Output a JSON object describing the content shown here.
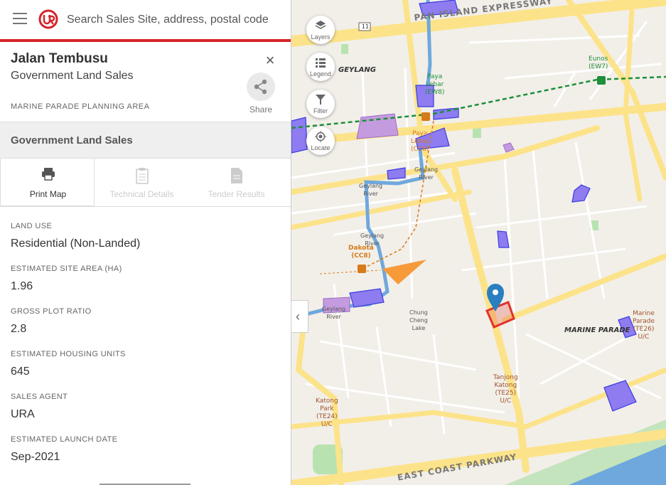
{
  "search": {
    "placeholder": "Search Sales Site, address, postal code"
  },
  "detail": {
    "title": "Jalan Tembusu",
    "subtitle": "Government Land Sales",
    "area": "MARINE PARADE PLANNING AREA",
    "share_label": "Share",
    "close_symbol": "×"
  },
  "section": {
    "title": "Government Land Sales"
  },
  "actions": [
    {
      "label": "Print Map",
      "icon": "printer-icon",
      "enabled": true
    },
    {
      "label": "Technical Details",
      "icon": "clipboard-icon",
      "enabled": false
    },
    {
      "label": "Tender Results",
      "icon": "document-icon",
      "enabled": false
    }
  ],
  "fields": [
    {
      "label": "LAND USE",
      "value": "Residential (Non-Landed)"
    },
    {
      "label": "ESTIMATED SITE AREA (HA)",
      "value": "1.96"
    },
    {
      "label": "GROSS PLOT RATIO",
      "value": "2.8"
    },
    {
      "label": "ESTIMATED HOUSING UNITS",
      "value": "645"
    },
    {
      "label": "SALES AGENT",
      "value": "URA"
    },
    {
      "label": "ESTIMATED LAUNCH DATE",
      "value": "Sep-2021"
    }
  ],
  "map_tools": [
    {
      "label": "Layers",
      "icon": "layers-icon"
    },
    {
      "label": "Legend",
      "icon": "legend-icon"
    },
    {
      "label": "Filter",
      "icon": "filter-icon"
    },
    {
      "label": "Locate",
      "icon": "locate-icon"
    }
  ],
  "map_labels": {
    "expressway": "PAN ISLAND EXPRESSWAY",
    "parkway": "EAST COAST PARKWAY",
    "route_shield": "11",
    "geylang": "GEYLANG",
    "marine_parade": "MARINE PARADE",
    "eunos": "Eunos\n(EW7)",
    "paya_lebar_ew": "Paya\nLebar\n(EW8)",
    "paya_lebar_cc": "Paya\nLebar\n(CC8)",
    "dakota": "Dakota\n(CC8)",
    "tanjong_katong": "Tanjong\nKatong\n(TE25)\nU/C",
    "katong_park": "Katong\nPark\n(TE24)\nU/C",
    "marine_parade_stn": "Marine\nParade\n(TE26)\nU/C",
    "river_1": "Geylang\nRiver",
    "river_2": "Geylang\nRiver",
    "river_3": "Geylang\nRiver",
    "river_4": "Geylang\nRiver",
    "lake": "Chung\nCheng\nLake"
  },
  "colors": {
    "brand": "#d6232a",
    "road": "#fce38a",
    "water": "#6fa8dc",
    "gls_site": "#8e7cf0",
    "selected_site": "#e0332b",
    "marker": "#2a7fc1",
    "mrt_ew": "#1f8f3a",
    "mrt_cc": "#d67a1a"
  }
}
